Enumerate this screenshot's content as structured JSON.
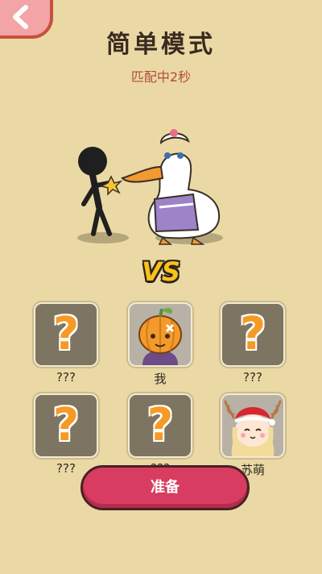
{
  "header": {
    "back_icon": "chevron-left-icon",
    "title": "简单模式",
    "timer": "匹配中2秒"
  },
  "vs_label": "VS",
  "slots": [
    {
      "name": "???",
      "type": "unknown"
    },
    {
      "name": "我",
      "type": "avatar",
      "icon": "pumpkin-avatar-icon"
    },
    {
      "name": "???",
      "type": "unknown"
    },
    {
      "name": "???",
      "type": "unknown"
    },
    {
      "name": "???",
      "type": "unknown"
    },
    {
      "name": "苏萌",
      "type": "avatar",
      "icon": "reindeer-girl-avatar-icon"
    }
  ],
  "question_mark": "?",
  "ready_button": "准备",
  "colors": {
    "background": "#ead9a4",
    "title": "#3a2a21",
    "timer": "#b44a40",
    "vs": "#f7c21b",
    "question_mark": "#f59a25",
    "ready_button": "#d83d61",
    "back_button": "#f3a4a6"
  }
}
